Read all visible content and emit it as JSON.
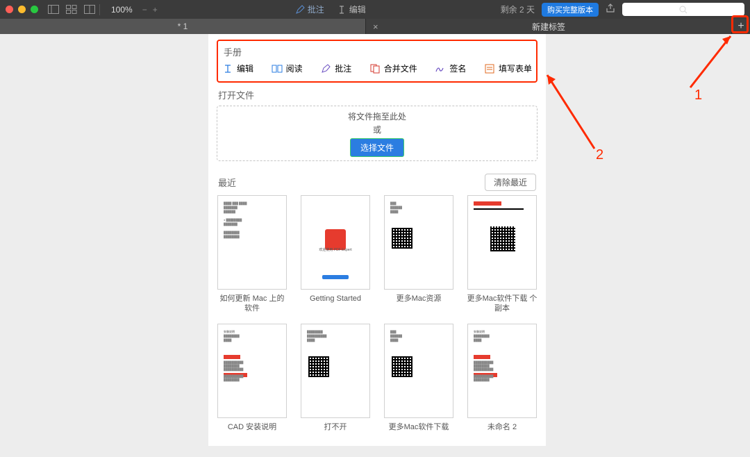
{
  "toolbar": {
    "zoom": "100%",
    "annotate": "批注",
    "edit": "编辑",
    "trial": "剩余 2 天",
    "buy": "购买完整版本"
  },
  "tabs": {
    "inactive": "* 1",
    "active": "新建标签"
  },
  "handbook": {
    "title": "手册",
    "items": [
      {
        "label": "编辑"
      },
      {
        "label": "阅读"
      },
      {
        "label": "批注"
      },
      {
        "label": "合并文件"
      },
      {
        "label": "签名"
      },
      {
        "label": "填写表单"
      }
    ]
  },
  "open": {
    "title": "打开文件",
    "drag": "将文件拖至此处",
    "or": "或",
    "select": "选择文件"
  },
  "recent": {
    "title": "最近",
    "clear": "清除最近",
    "docs": [
      "如何更新 Mac 上的软件",
      "Getting Started",
      "更多Mac资源",
      "更多Mac软件下载 个副本",
      "CAD 安装说明",
      "打不开",
      "更多Mac软件下载",
      "未命名 2"
    ]
  },
  "annotations": {
    "n1": "1",
    "n2": "2"
  }
}
